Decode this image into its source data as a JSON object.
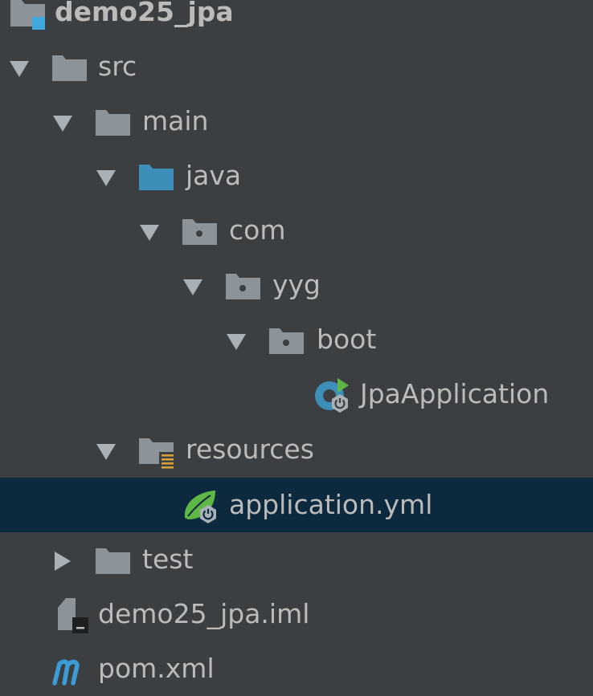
{
  "colors": {
    "background": "#3c3f41",
    "selection": "#0d293e",
    "text": "#bbbbbb",
    "folder_gray": "#8c9399",
    "source_folder_blue": "#3d8eb9",
    "resources_orange": "#d6a038",
    "spring_green": "#5fb846",
    "maven_blue": "#3b9cd6"
  },
  "tree": {
    "root": {
      "label": "demo25_jpa",
      "icon": "module-folder-icon"
    },
    "src": {
      "label": "src",
      "icon": "folder-icon",
      "expanded": true
    },
    "main": {
      "label": "main",
      "icon": "folder-icon",
      "expanded": true
    },
    "java": {
      "label": "java",
      "icon": "source-root-folder-icon",
      "expanded": true
    },
    "com": {
      "label": "com",
      "icon": "package-icon",
      "expanded": true
    },
    "yyg": {
      "label": "yyg",
      "icon": "package-icon",
      "expanded": true
    },
    "boot": {
      "label": "boot",
      "icon": "package-icon",
      "expanded": true
    },
    "jpa_application": {
      "label": "JpaApplication",
      "icon": "spring-boot-class-icon"
    },
    "resources": {
      "label": "resources",
      "icon": "resources-root-folder-icon",
      "expanded": true
    },
    "application_yml": {
      "label": "application.yml",
      "icon": "spring-config-file-icon",
      "selected": true
    },
    "test": {
      "label": "test",
      "icon": "folder-icon",
      "expanded": false
    },
    "iml": {
      "label": "demo25_jpa.iml",
      "icon": "iml-file-icon"
    },
    "pom": {
      "label": "pom.xml",
      "icon": "maven-icon"
    }
  }
}
